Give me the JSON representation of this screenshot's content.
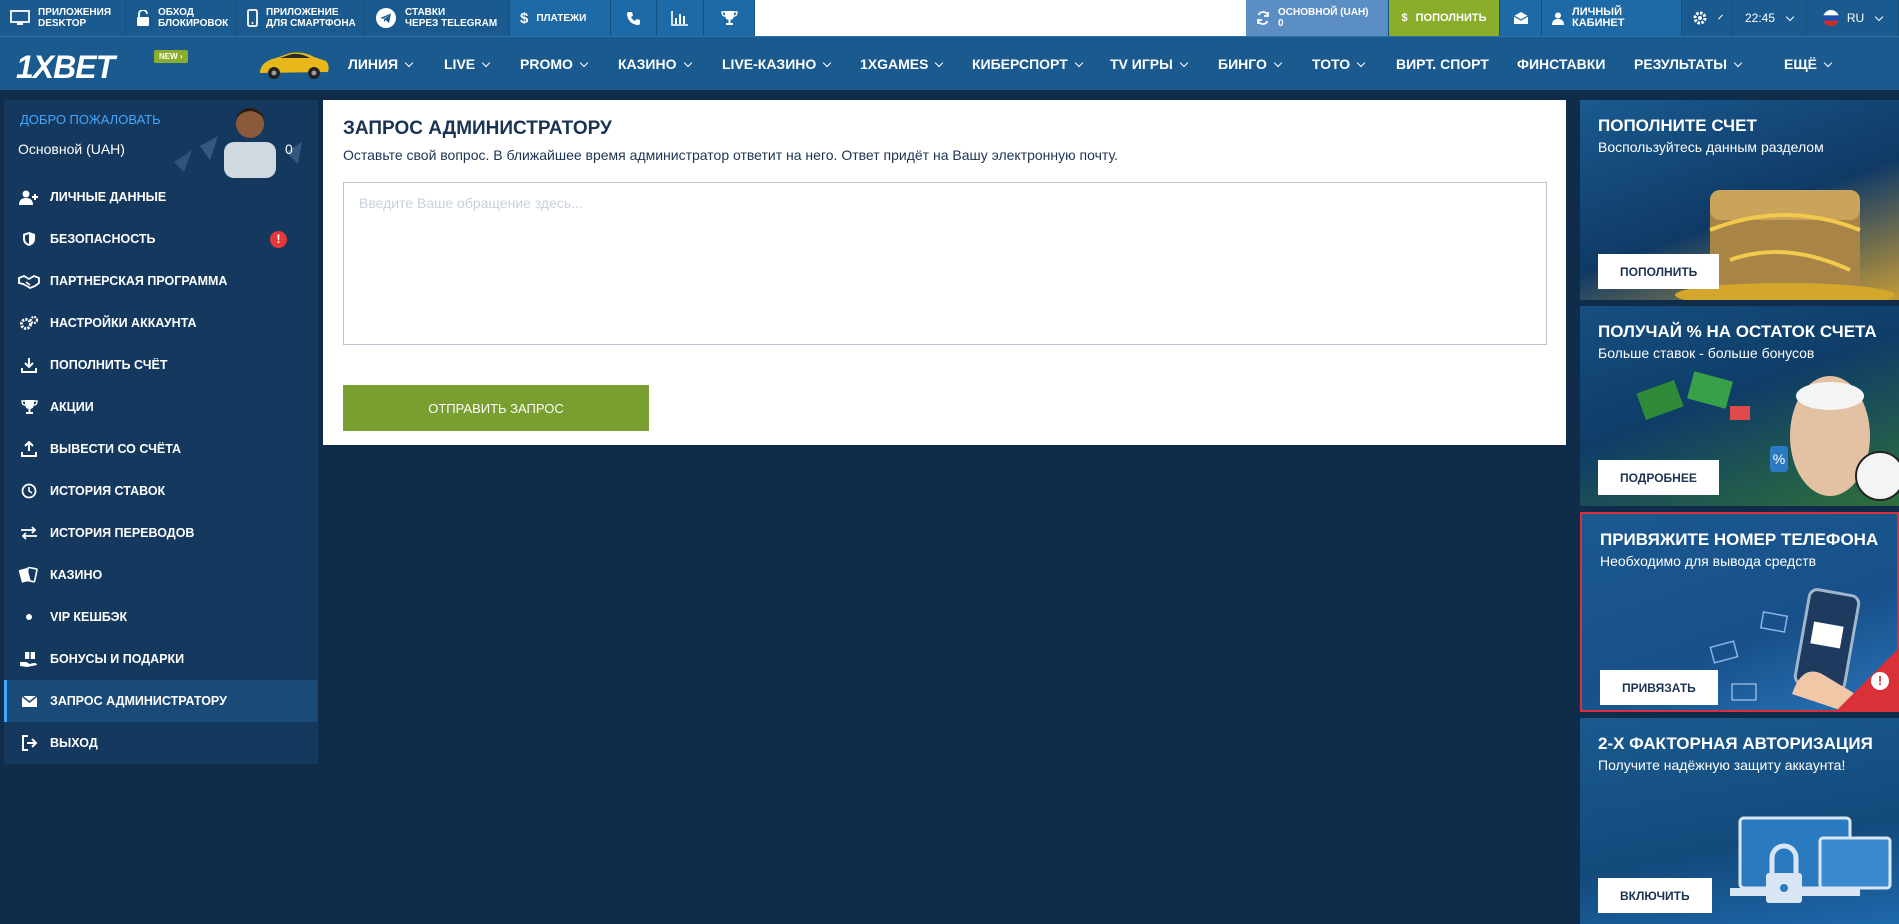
{
  "topbar": {
    "items": [
      {
        "label": "ПРИЛОЖЕНИЯ\nDESKTOP",
        "icon": "desktop-icon"
      },
      {
        "label": "ОБХОД\nБЛОКИРОВОК",
        "icon": "unlock-icon"
      },
      {
        "label": "ПРИЛОЖЕНИЕ\nДЛЯ СМАРТФОНА",
        "icon": "smartphone-icon"
      },
      {
        "label": "СТАВКИ\nЧЕРЕЗ TELEGRAM",
        "icon": "telegram-icon"
      },
      {
        "label": "ПЛАТЕЖИ",
        "icon": "dollar-icon"
      }
    ],
    "balance_label": "ОСНОВНОЙ (UAH)",
    "balance_value": "0",
    "deposit_label": "ПОПОЛНИТЬ",
    "cabinet_label": "ЛИЧНЫЙ КАБИНЕТ",
    "time": "22:45",
    "lang": "RU"
  },
  "nav": {
    "logo": "1XBET",
    "badge": "NEW",
    "items": [
      "ЛИНИЯ",
      "LIVE",
      "PROMO",
      "КАЗИНО",
      "LIVE-КАЗИНО",
      "1XGAMES",
      "КИБЕРСПОРТ",
      "TV ИГРЫ",
      "БИНГО",
      "ТОТО",
      "ВИРТ. СПОРТ",
      "ФИНСТАВКИ",
      "РЕЗУЛЬТАТЫ",
      "ЕЩЁ"
    ]
  },
  "sidebar": {
    "welcome": "ДОБРО ПОЖАЛОВАТЬ",
    "account": "Основной (UAH)",
    "balance": "0",
    "items": [
      {
        "label": "ЛИЧНЫЕ ДАННЫЕ",
        "icon": "user-add-icon"
      },
      {
        "label": "БЕЗОПАСНОСТЬ",
        "icon": "shield-icon"
      },
      {
        "label": "ПАРТНЕРСКАЯ ПРОГРАММА",
        "icon": "handshake-icon"
      },
      {
        "label": "НАСТРОЙКИ АККАУНТА",
        "icon": "gears-icon"
      },
      {
        "label": "ПОПОЛНИТЬ СЧЁТ",
        "icon": "download-icon"
      },
      {
        "label": "АКЦИИ",
        "icon": "trophy-icon"
      },
      {
        "label": "ВЫВЕСТИ СО СЧЁТА",
        "icon": "upload-icon"
      },
      {
        "label": "ИСТОРИЯ СТАВОК",
        "icon": "clock-icon"
      },
      {
        "label": "ИСТОРИЯ ПЕРЕВОДОВ",
        "icon": "transfer-icon"
      },
      {
        "label": "КАЗИНО",
        "icon": "cards-icon"
      },
      {
        "label": "VIP КЕШБЭК",
        "icon": "dot-icon"
      },
      {
        "label": "БОНУСЫ И ПОДАРКИ",
        "icon": "gift-hand-icon"
      },
      {
        "label": "ЗАПРОС АДМИНИСТРАТОРУ",
        "icon": "envelope-icon"
      },
      {
        "label": "ВЫХОД",
        "icon": "logout-icon"
      }
    ]
  },
  "main": {
    "title": "ЗАПРОС АДМИНИСТРАТОРУ",
    "description": "Оставьте свой вопрос. В ближайшее время администратор ответит на него. Ответ придёт на Вашу электронную почту.",
    "placeholder": "Введите Ваше обращение здесь...",
    "submit_label": "ОТПРАВИТЬ ЗАПРОС"
  },
  "banners": [
    {
      "title": "ПОПОЛНИТЕ СЧЕТ",
      "subtitle": "Воспользуйтесь данным разделом",
      "button": "ПОПОЛНИТЬ"
    },
    {
      "title": "ПОЛУЧАЙ % НА ОСТАТОК СЧЕТА",
      "subtitle": "Больше ставок - больше бонусов",
      "button": "ПОДРОБНЕЕ"
    },
    {
      "title": "ПРИВЯЖИТЕ НОМЕР ТЕЛЕФОНА",
      "subtitle": "Необходимо для вывода средств",
      "button": "ПРИВЯЗАТЬ"
    },
    {
      "title": "2-Х ФАКТОРНАЯ АВТОРИЗАЦИЯ",
      "subtitle": "Получите надёжную защиту аккаунта!",
      "button": "ВКЛЮЧИТЬ"
    }
  ],
  "colors": {
    "primary": "#1a5a8f",
    "background": "#0f2d4b",
    "accent_green": "#8aad2c",
    "alert_red": "#e5383b"
  }
}
